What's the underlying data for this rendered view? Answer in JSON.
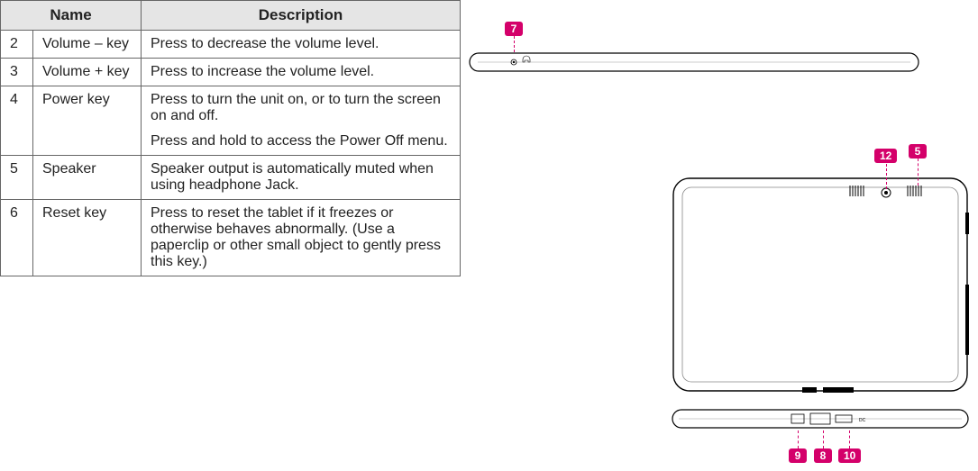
{
  "table": {
    "headers": {
      "name": "Name",
      "description": "Description"
    },
    "rows": [
      {
        "num": "2",
        "name": "Volume – key",
        "desc": [
          "Press to decrease the volume level."
        ]
      },
      {
        "num": "3",
        "name": "Volume + key",
        "desc": [
          "Press to increase the volume level."
        ]
      },
      {
        "num": "4",
        "name": "Power key",
        "desc": [
          "Press to turn the unit on, or to turn the screen on and off.",
          "Press and hold to access the Power Off menu."
        ]
      },
      {
        "num": "5",
        "name": "Speaker",
        "desc": [
          "Speaker output is automatically muted when using headphone Jack."
        ]
      },
      {
        "num": "6",
        "name": "Reset key",
        "desc": [
          "Press to reset the tablet if it freezes or otherwise behaves abnormally. (Use a paperclip or other small object to gently press this key.)"
        ]
      }
    ]
  },
  "callouts": {
    "c7": "7",
    "c12": "12",
    "c5": "5",
    "c9": "9",
    "c8": "8",
    "c10": "10"
  }
}
